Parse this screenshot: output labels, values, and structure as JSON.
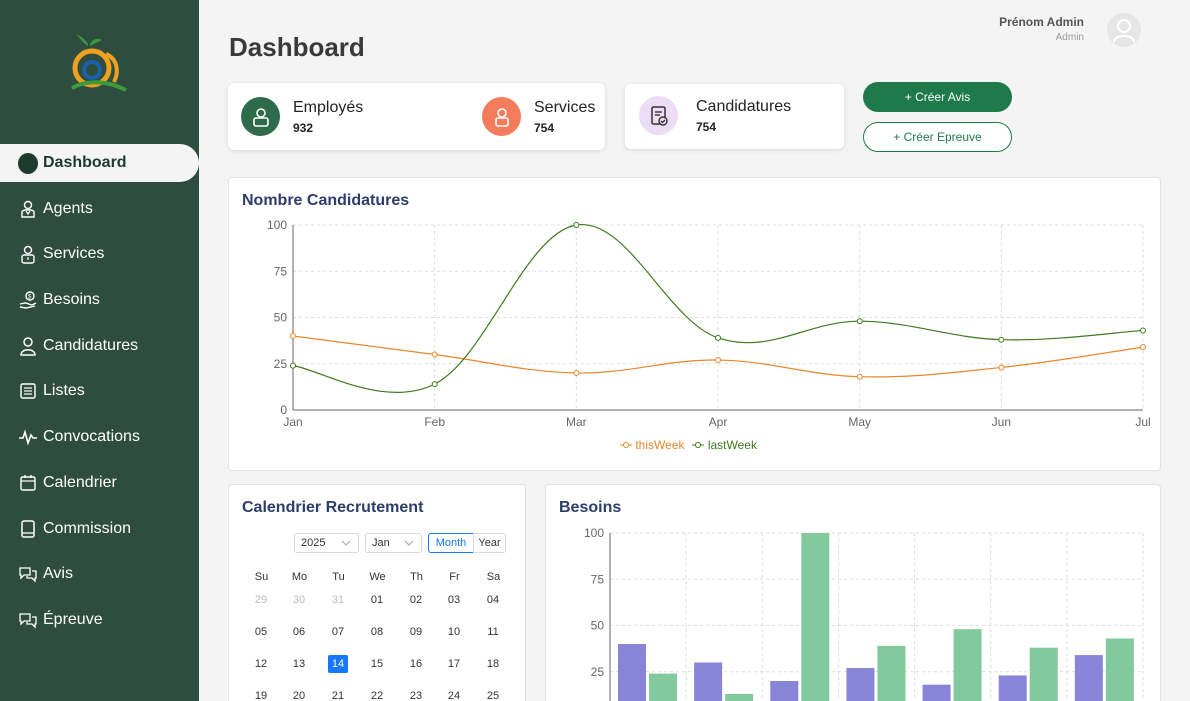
{
  "sidebar": {
    "items": [
      {
        "label": "Dashboard",
        "icon": "dashboard-dot-icon",
        "active": true
      },
      {
        "label": "Agents",
        "icon": "agent-icon"
      },
      {
        "label": "Services",
        "icon": "service-person-icon"
      },
      {
        "label": "Besoins",
        "icon": "hand-coin-icon"
      },
      {
        "label": "Candidatures",
        "icon": "person-icon"
      },
      {
        "label": "Listes",
        "icon": "list-icon"
      },
      {
        "label": "Convocations",
        "icon": "pulse-icon"
      },
      {
        "label": "Calendrier",
        "icon": "calendar-icon"
      },
      {
        "label": "Commission",
        "icon": "book-icon"
      },
      {
        "label": "Avis",
        "icon": "chat-icon"
      },
      {
        "label": "Épreuve",
        "icon": "chat-icon"
      }
    ]
  },
  "header": {
    "title": "Dashboard",
    "user_name": "Prénom Admin",
    "user_role": "Admin"
  },
  "stats": {
    "employes": {
      "label": "Employés",
      "value": "932"
    },
    "services": {
      "label": "Services",
      "value": "754"
    },
    "candidatures": {
      "label": "Candidatures",
      "value": "754"
    }
  },
  "actions": {
    "create_avis": "+ Créer Avis",
    "create_epreuve": "+ Créer Epreuve"
  },
  "colors": {
    "sidebar": "#2e4d3f",
    "primary": "#1e7a4a",
    "this_week": "#e8862a",
    "last_week": "#3d7a1c",
    "bar_a": "#8884d8",
    "bar_b": "#82ca9d"
  },
  "line_chart_panel": {
    "title": "Nombre Candidatures"
  },
  "calendar_panel": {
    "title": "Calendrier Recrutement",
    "year": "2025",
    "month": "Jan",
    "mode_month": "Month",
    "mode_year": "Year",
    "weekdays": [
      "Su",
      "Mo",
      "Tu",
      "We",
      "Th",
      "Fr",
      "Sa"
    ],
    "weeks": [
      [
        "29",
        "30",
        "31",
        "01",
        "02",
        "03",
        "04"
      ],
      [
        "05",
        "06",
        "07",
        "08",
        "09",
        "10",
        "11"
      ],
      [
        "12",
        "13",
        "14",
        "15",
        "16",
        "17",
        "18"
      ],
      [
        "19",
        "20",
        "21",
        "22",
        "23",
        "24",
        "25"
      ]
    ],
    "selected": "14"
  },
  "bar_chart_panel": {
    "title": "Besoins"
  },
  "chart_data": [
    {
      "type": "line",
      "title": "Nombre Candidatures",
      "categories": [
        "Jan",
        "Feb",
        "Mar",
        "Apr",
        "May",
        "Jun",
        "Jul"
      ],
      "ylim": [
        0,
        100
      ],
      "yticks": [
        "0",
        "25",
        "50",
        "75",
        "100"
      ],
      "grid": true,
      "legend": "bottom-center",
      "series": [
        {
          "name": "thisWeek",
          "values": [
            40,
            30,
            20,
            27,
            18,
            23,
            34
          ]
        },
        {
          "name": "lastWeek",
          "values": [
            24,
            14,
            100,
            39,
            48,
            38,
            43
          ]
        }
      ]
    },
    {
      "type": "bar",
      "title": "Besoins",
      "ylim": [
        0,
        100
      ],
      "yticks": [
        "25",
        "50",
        "75",
        "100"
      ],
      "grid": true,
      "series": [
        {
          "values": [
            40,
            30,
            20,
            27,
            18,
            23,
            34
          ]
        },
        {
          "values": [
            24,
            13,
            100,
            39,
            48,
            38,
            43
          ]
        }
      ]
    }
  ]
}
